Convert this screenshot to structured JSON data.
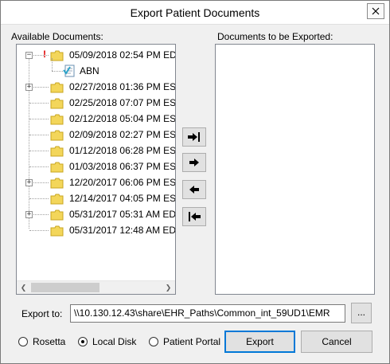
{
  "window": {
    "title": "Export Patient Documents"
  },
  "available_label": "Available Documents:",
  "export_list_label": "Documents to be Exported:",
  "tree": [
    {
      "label": "05/09/2018 02:54 PM ED",
      "flag": "!",
      "expanded": true
    },
    {
      "label": "ABN",
      "type": "document"
    },
    {
      "label": "02/27/2018 01:36 PM ES",
      "collapsed": true
    },
    {
      "label": "02/25/2018 07:07 PM ES"
    },
    {
      "label": "02/12/2018 05:04 PM ES"
    },
    {
      "label": "02/09/2018 02:27 PM ES"
    },
    {
      "label": "01/12/2018 06:28 PM ES"
    },
    {
      "label": "01/03/2018 06:37 PM ES"
    },
    {
      "label": "12/20/2017 06:06 PM ES",
      "collapsed": true
    },
    {
      "label": "12/14/2017 04:05 PM ES"
    },
    {
      "label": "05/31/2017 05:31 AM ED",
      "collapsed": true
    },
    {
      "label": "05/31/2017 12:48 AM ED"
    }
  ],
  "move_buttons": [
    {
      "icon": "move-all-right-icon"
    },
    {
      "icon": "move-right-icon"
    },
    {
      "icon": "move-left-icon"
    },
    {
      "icon": "move-all-left-icon"
    }
  ],
  "export_to": {
    "label": "Export to:",
    "value": "\\\\10.130.12.43\\share\\EHR_Paths\\Common_int_59UD1\\EMR",
    "browse_label": "..."
  },
  "destinations": [
    {
      "label": "Rosetta",
      "selected": false
    },
    {
      "label": "Local Disk",
      "selected": true
    },
    {
      "label": "Patient Portal",
      "selected": false
    }
  ],
  "buttons": {
    "export": "Export",
    "cancel": "Cancel"
  },
  "colors": {
    "folder": "#f3d65a",
    "folder_edge": "#c8a620",
    "flag": "#e00000",
    "focus": "#0078d7"
  }
}
